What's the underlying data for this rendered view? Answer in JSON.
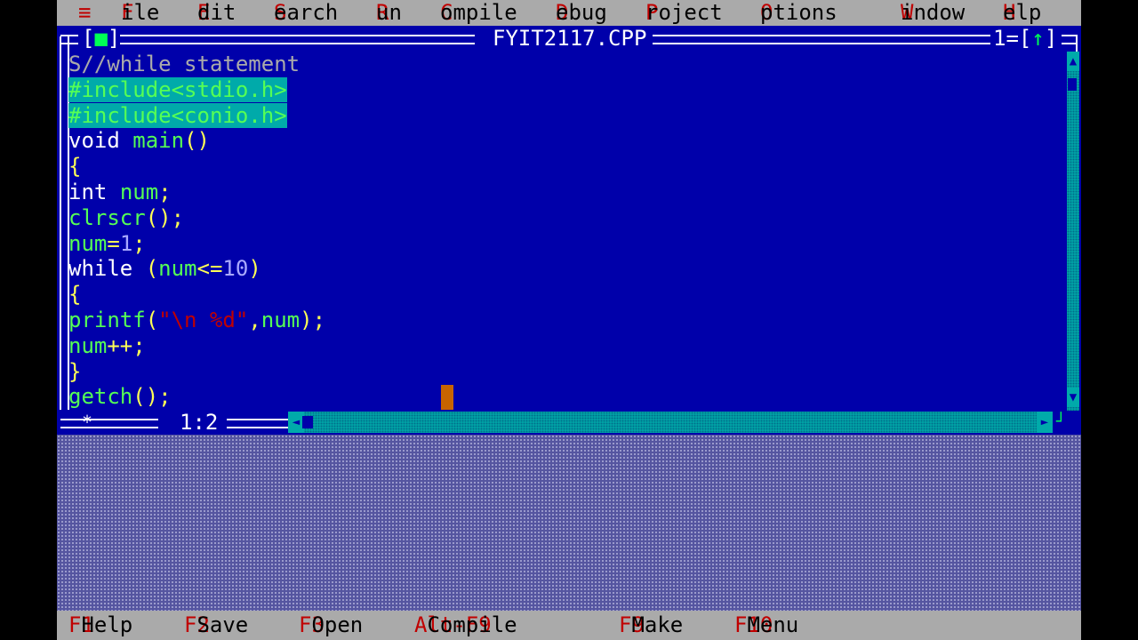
{
  "menu": [
    {
      "hot": "≡",
      "rest": ""
    },
    {
      "hot": "F",
      "rest": "ile"
    },
    {
      "hot": "E",
      "rest": "dit"
    },
    {
      "hot": "S",
      "rest": "earch"
    },
    {
      "hot": "R",
      "rest": "un"
    },
    {
      "hot": "C",
      "rest": "ompile"
    },
    {
      "hot": "D",
      "rest": "ebug"
    },
    {
      "hot": "P",
      "rest": "roject"
    },
    {
      "hot": "O",
      "rest": "ptions"
    },
    {
      "hot": "W",
      "rest": "indow"
    },
    {
      "hot": "H",
      "rest": "elp"
    }
  ],
  "window": {
    "title": "FYIT2117.CPP",
    "close_box": {
      "left": "[",
      "mark": "■",
      "right": "]"
    },
    "number": "1=",
    "zoom_box": {
      "left": "[",
      "mark": "↑",
      "right": "]"
    },
    "cursor_position": "1:2",
    "modified_marker": "*"
  },
  "code_lines": [
    {
      "tokens": [
        {
          "t": "S//while statement",
          "c": "cm"
        }
      ],
      "selected": false
    },
    {
      "tokens": [
        {
          "t": "#include<stdio.h>",
          "c": "id"
        }
      ],
      "selected": true
    },
    {
      "tokens": [
        {
          "t": "#include<conio.h>",
          "c": "id"
        }
      ],
      "selected": true
    },
    {
      "tokens": [
        {
          "t": "void",
          "c": "kw"
        },
        {
          "t": " ",
          "c": "kw"
        },
        {
          "t": "main",
          "c": "id"
        },
        {
          "t": "()",
          "c": "pn"
        }
      ],
      "selected": false
    },
    {
      "tokens": [
        {
          "t": "{",
          "c": "pn"
        }
      ],
      "selected": false
    },
    {
      "tokens": [
        {
          "t": "int",
          "c": "kw"
        },
        {
          "t": " ",
          "c": "kw"
        },
        {
          "t": "num",
          "c": "id"
        },
        {
          "t": ";",
          "c": "pn"
        }
      ],
      "selected": false
    },
    {
      "tokens": [
        {
          "t": "clrscr",
          "c": "id"
        },
        {
          "t": "();",
          "c": "pn"
        }
      ],
      "selected": false
    },
    {
      "tokens": [
        {
          "t": "num",
          "c": "id"
        },
        {
          "t": "=",
          "c": "pn"
        },
        {
          "t": "1",
          "c": "num"
        },
        {
          "t": ";",
          "c": "pn"
        }
      ],
      "selected": false
    },
    {
      "tokens": [
        {
          "t": "while",
          "c": "kw"
        },
        {
          "t": " ",
          "c": "kw"
        },
        {
          "t": "(",
          "c": "pn"
        },
        {
          "t": "num",
          "c": "id"
        },
        {
          "t": "<=",
          "c": "pn"
        },
        {
          "t": "10",
          "c": "num"
        },
        {
          "t": ")",
          "c": "pn"
        }
      ],
      "selected": false
    },
    {
      "tokens": [
        {
          "t": "{",
          "c": "pn"
        }
      ],
      "selected": false
    },
    {
      "tokens": [
        {
          "t": "printf",
          "c": "id"
        },
        {
          "t": "(",
          "c": "pn"
        },
        {
          "t": "\"\\n %d\"",
          "c": "str"
        },
        {
          "t": ",",
          "c": "pn"
        },
        {
          "t": "num",
          "c": "id"
        },
        {
          "t": ");",
          "c": "pn"
        }
      ],
      "selected": false
    },
    {
      "tokens": [
        {
          "t": "num",
          "c": "id"
        },
        {
          "t": "++;",
          "c": "pn"
        }
      ],
      "selected": false
    },
    {
      "tokens": [
        {
          "t": "}",
          "c": "pn"
        }
      ],
      "selected": false
    },
    {
      "tokens": [
        {
          "t": "getch",
          "c": "id"
        },
        {
          "t": "();",
          "c": "pn"
        }
      ],
      "selected": false
    }
  ],
  "scrollbar": {
    "up": "▲",
    "down": "▼",
    "left": "◄",
    "right": "►"
  },
  "status": [
    {
      "key": "F1",
      "label": "Help"
    },
    {
      "key": "F2",
      "label": "Save"
    },
    {
      "key": "F3",
      "label": "Open"
    },
    {
      "key": "Alt-F9",
      "label": "Compile"
    },
    {
      "key": "F9",
      "label": "Make"
    },
    {
      "key": "F10",
      "label": "Menu"
    }
  ],
  "colors": {
    "editor_bg": "#0000aa",
    "selection": "#00aaaa",
    "menu_bg": "#aaaaaa",
    "hotkey": "#c00000",
    "cursor": "#c86400"
  }
}
